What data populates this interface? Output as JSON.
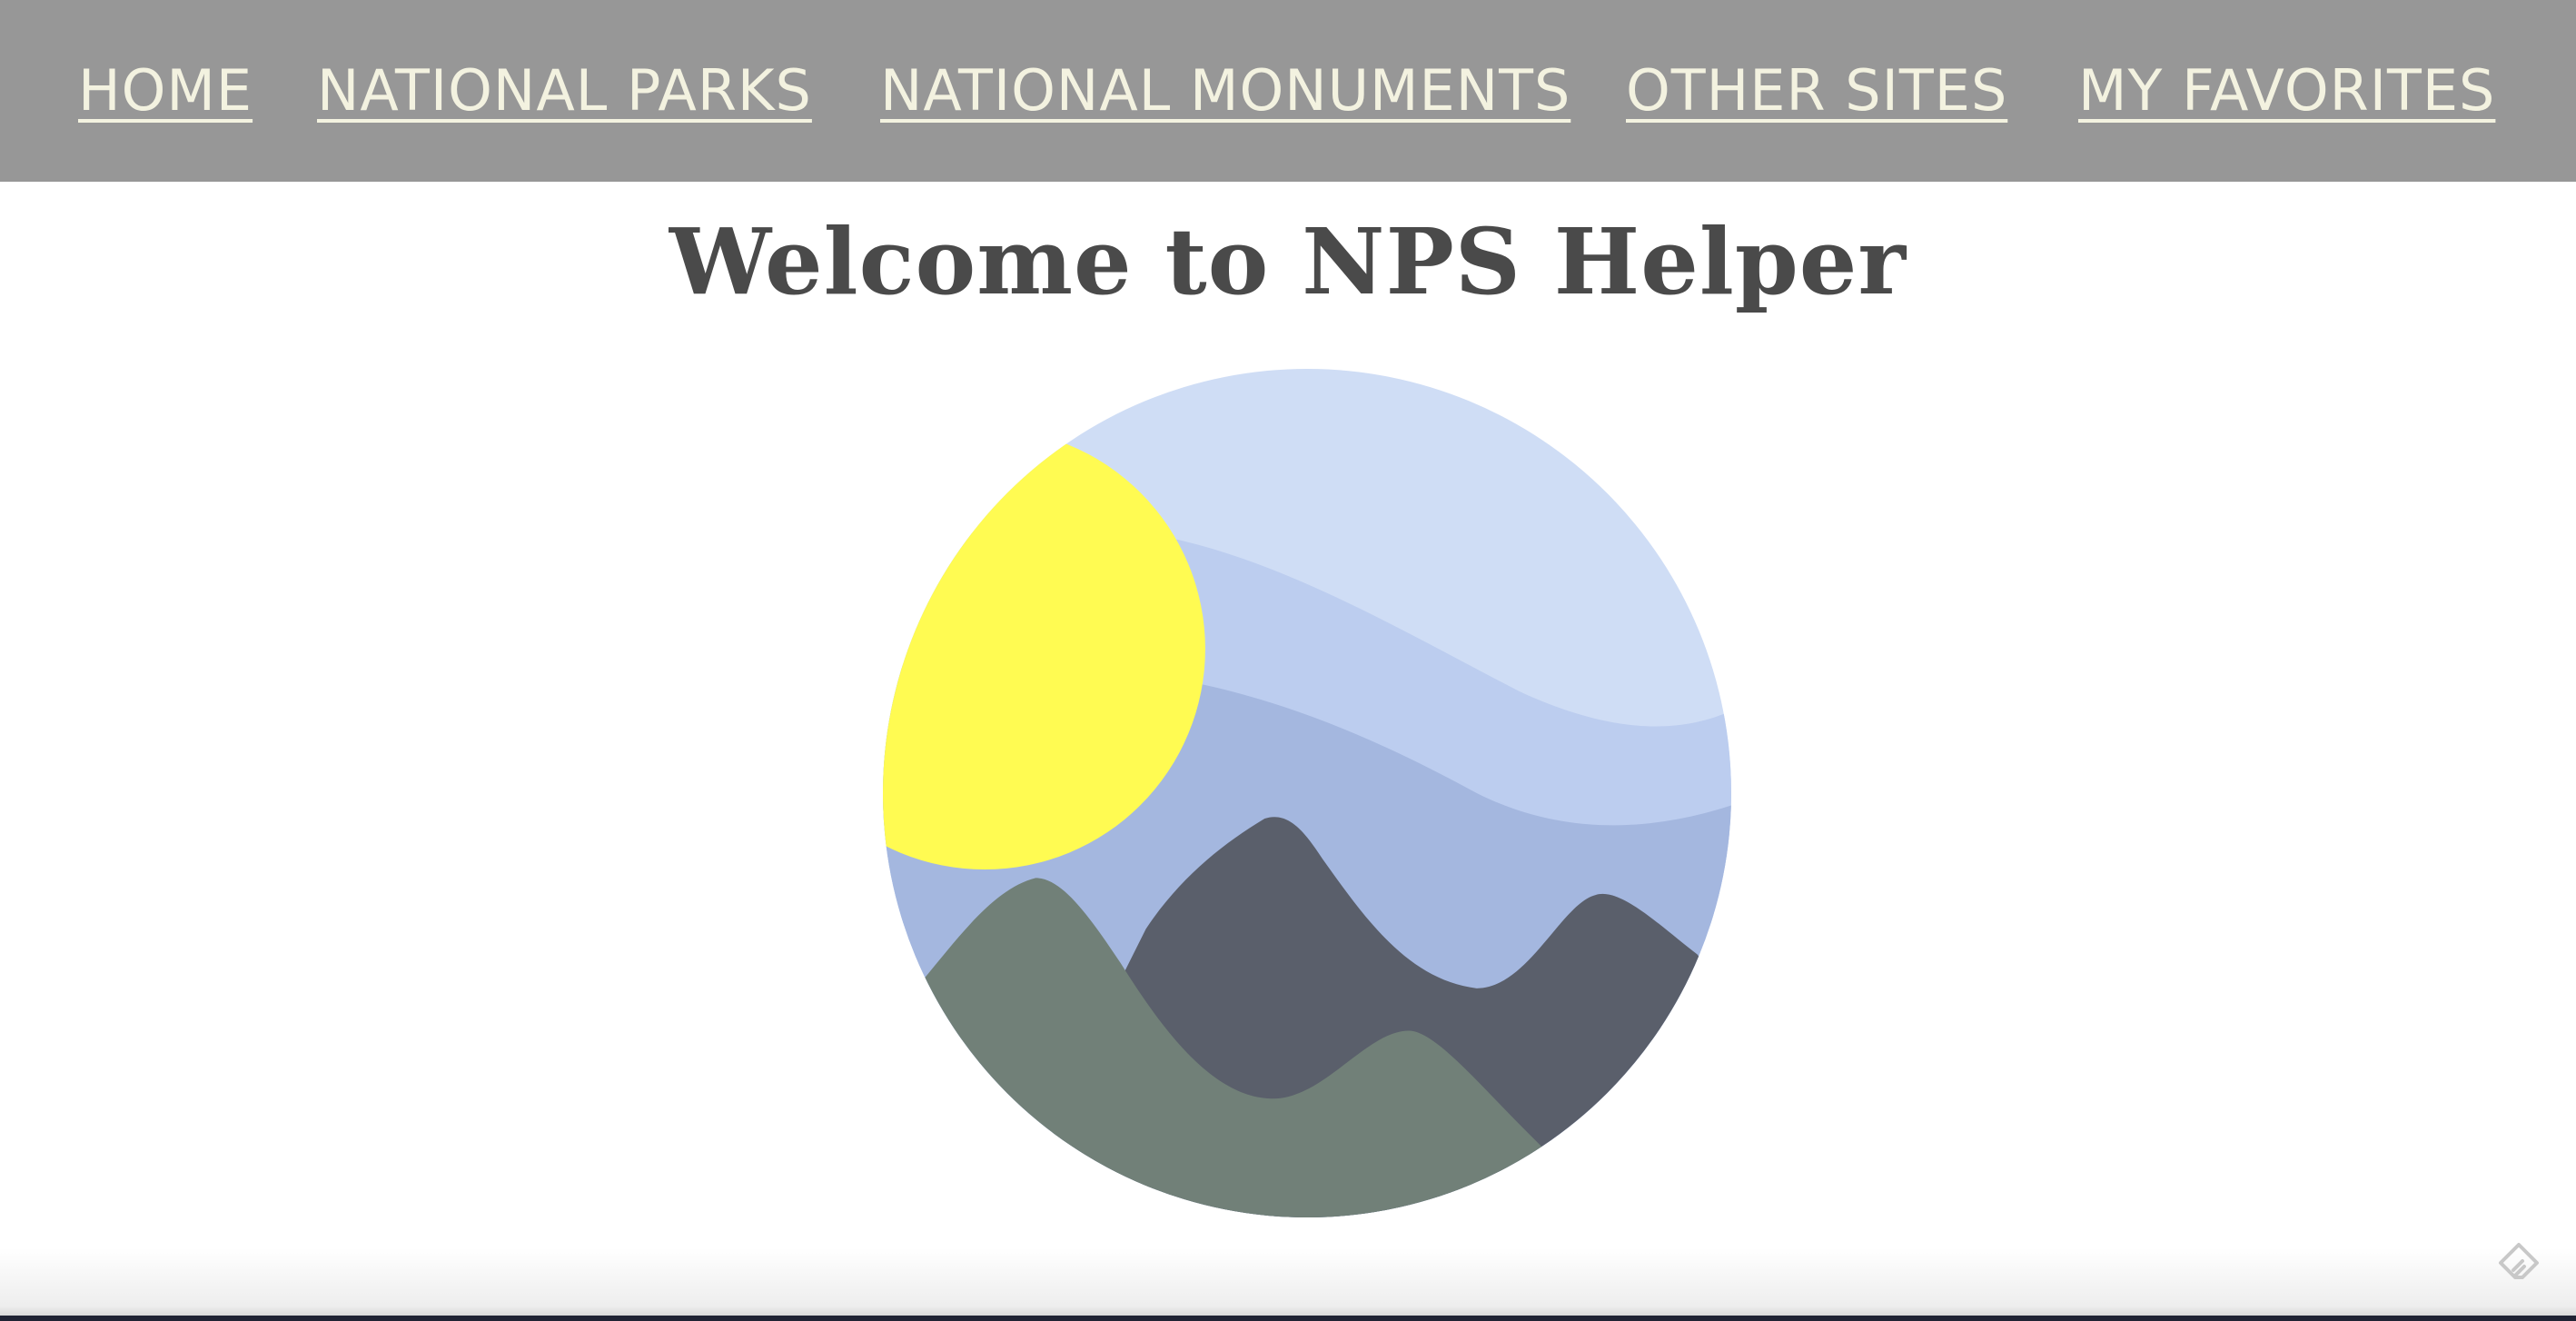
{
  "nav": {
    "items": [
      {
        "label": "HOME"
      },
      {
        "label": "NATIONAL PARKS"
      },
      {
        "label": "NATIONAL MONUMENTS"
      },
      {
        "label": "OTHER SITES"
      },
      {
        "label": "MY FAVORITES"
      }
    ]
  },
  "main": {
    "title": "Welcome to NPS Helper",
    "logo_icon": "mountains-sun-landscape-icon"
  },
  "corner": {
    "icon": "feedly-icon"
  },
  "colors": {
    "nav_bg": "#979797",
    "nav_text": "#f3f2e0",
    "title": "#4a4a4a",
    "sky_light": "#cfddf5",
    "sky_mid": "#bccdef",
    "sky_dark": "#a4b7df",
    "sun": "#fffb52",
    "mountain_dark": "#5a5f6b",
    "mountain_green": "#718078"
  }
}
